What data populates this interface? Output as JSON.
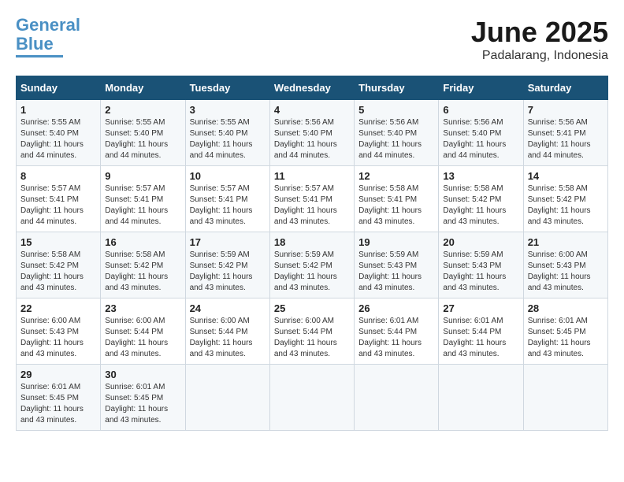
{
  "logo": {
    "line1": "General",
    "line2": "Blue"
  },
  "title": "June 2025",
  "location": "Padalarang, Indonesia",
  "days_header": [
    "Sunday",
    "Monday",
    "Tuesday",
    "Wednesday",
    "Thursday",
    "Friday",
    "Saturday"
  ],
  "weeks": [
    [
      {
        "day": "1",
        "sunrise": "Sunrise: 5:55 AM",
        "sunset": "Sunset: 5:40 PM",
        "daylight": "Daylight: 11 hours and 44 minutes."
      },
      {
        "day": "2",
        "sunrise": "Sunrise: 5:55 AM",
        "sunset": "Sunset: 5:40 PM",
        "daylight": "Daylight: 11 hours and 44 minutes."
      },
      {
        "day": "3",
        "sunrise": "Sunrise: 5:55 AM",
        "sunset": "Sunset: 5:40 PM",
        "daylight": "Daylight: 11 hours and 44 minutes."
      },
      {
        "day": "4",
        "sunrise": "Sunrise: 5:56 AM",
        "sunset": "Sunset: 5:40 PM",
        "daylight": "Daylight: 11 hours and 44 minutes."
      },
      {
        "day": "5",
        "sunrise": "Sunrise: 5:56 AM",
        "sunset": "Sunset: 5:40 PM",
        "daylight": "Daylight: 11 hours and 44 minutes."
      },
      {
        "day": "6",
        "sunrise": "Sunrise: 5:56 AM",
        "sunset": "Sunset: 5:40 PM",
        "daylight": "Daylight: 11 hours and 44 minutes."
      },
      {
        "day": "7",
        "sunrise": "Sunrise: 5:56 AM",
        "sunset": "Sunset: 5:41 PM",
        "daylight": "Daylight: 11 hours and 44 minutes."
      }
    ],
    [
      {
        "day": "8",
        "sunrise": "Sunrise: 5:57 AM",
        "sunset": "Sunset: 5:41 PM",
        "daylight": "Daylight: 11 hours and 44 minutes."
      },
      {
        "day": "9",
        "sunrise": "Sunrise: 5:57 AM",
        "sunset": "Sunset: 5:41 PM",
        "daylight": "Daylight: 11 hours and 44 minutes."
      },
      {
        "day": "10",
        "sunrise": "Sunrise: 5:57 AM",
        "sunset": "Sunset: 5:41 PM",
        "daylight": "Daylight: 11 hours and 43 minutes."
      },
      {
        "day": "11",
        "sunrise": "Sunrise: 5:57 AM",
        "sunset": "Sunset: 5:41 PM",
        "daylight": "Daylight: 11 hours and 43 minutes."
      },
      {
        "day": "12",
        "sunrise": "Sunrise: 5:58 AM",
        "sunset": "Sunset: 5:41 PM",
        "daylight": "Daylight: 11 hours and 43 minutes."
      },
      {
        "day": "13",
        "sunrise": "Sunrise: 5:58 AM",
        "sunset": "Sunset: 5:42 PM",
        "daylight": "Daylight: 11 hours and 43 minutes."
      },
      {
        "day": "14",
        "sunrise": "Sunrise: 5:58 AM",
        "sunset": "Sunset: 5:42 PM",
        "daylight": "Daylight: 11 hours and 43 minutes."
      }
    ],
    [
      {
        "day": "15",
        "sunrise": "Sunrise: 5:58 AM",
        "sunset": "Sunset: 5:42 PM",
        "daylight": "Daylight: 11 hours and 43 minutes."
      },
      {
        "day": "16",
        "sunrise": "Sunrise: 5:58 AM",
        "sunset": "Sunset: 5:42 PM",
        "daylight": "Daylight: 11 hours and 43 minutes."
      },
      {
        "day": "17",
        "sunrise": "Sunrise: 5:59 AM",
        "sunset": "Sunset: 5:42 PM",
        "daylight": "Daylight: 11 hours and 43 minutes."
      },
      {
        "day": "18",
        "sunrise": "Sunrise: 5:59 AM",
        "sunset": "Sunset: 5:42 PM",
        "daylight": "Daylight: 11 hours and 43 minutes."
      },
      {
        "day": "19",
        "sunrise": "Sunrise: 5:59 AM",
        "sunset": "Sunset: 5:43 PM",
        "daylight": "Daylight: 11 hours and 43 minutes."
      },
      {
        "day": "20",
        "sunrise": "Sunrise: 5:59 AM",
        "sunset": "Sunset: 5:43 PM",
        "daylight": "Daylight: 11 hours and 43 minutes."
      },
      {
        "day": "21",
        "sunrise": "Sunrise: 6:00 AM",
        "sunset": "Sunset: 5:43 PM",
        "daylight": "Daylight: 11 hours and 43 minutes."
      }
    ],
    [
      {
        "day": "22",
        "sunrise": "Sunrise: 6:00 AM",
        "sunset": "Sunset: 5:43 PM",
        "daylight": "Daylight: 11 hours and 43 minutes."
      },
      {
        "day": "23",
        "sunrise": "Sunrise: 6:00 AM",
        "sunset": "Sunset: 5:44 PM",
        "daylight": "Daylight: 11 hours and 43 minutes."
      },
      {
        "day": "24",
        "sunrise": "Sunrise: 6:00 AM",
        "sunset": "Sunset: 5:44 PM",
        "daylight": "Daylight: 11 hours and 43 minutes."
      },
      {
        "day": "25",
        "sunrise": "Sunrise: 6:00 AM",
        "sunset": "Sunset: 5:44 PM",
        "daylight": "Daylight: 11 hours and 43 minutes."
      },
      {
        "day": "26",
        "sunrise": "Sunrise: 6:01 AM",
        "sunset": "Sunset: 5:44 PM",
        "daylight": "Daylight: 11 hours and 43 minutes."
      },
      {
        "day": "27",
        "sunrise": "Sunrise: 6:01 AM",
        "sunset": "Sunset: 5:44 PM",
        "daylight": "Daylight: 11 hours and 43 minutes."
      },
      {
        "day": "28",
        "sunrise": "Sunrise: 6:01 AM",
        "sunset": "Sunset: 5:45 PM",
        "daylight": "Daylight: 11 hours and 43 minutes."
      }
    ],
    [
      {
        "day": "29",
        "sunrise": "Sunrise: 6:01 AM",
        "sunset": "Sunset: 5:45 PM",
        "daylight": "Daylight: 11 hours and 43 minutes."
      },
      {
        "day": "30",
        "sunrise": "Sunrise: 6:01 AM",
        "sunset": "Sunset: 5:45 PM",
        "daylight": "Daylight: 11 hours and 43 minutes."
      },
      null,
      null,
      null,
      null,
      null
    ]
  ]
}
